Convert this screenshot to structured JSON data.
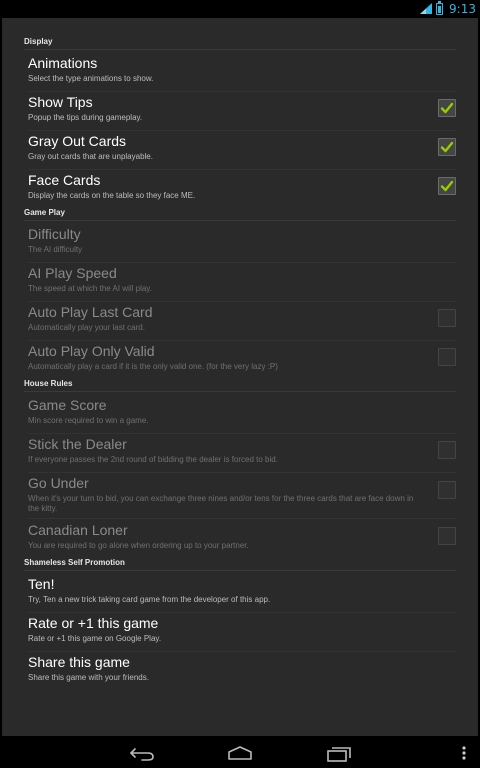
{
  "status_bar": {
    "time": "9:13"
  },
  "sections": {
    "display": "Display",
    "game_play": "Game Play",
    "house_rules": "House Rules",
    "promotion": "Shameless Self Promotion"
  },
  "prefs": {
    "animations": {
      "title": "Animations",
      "summary": "Select the type animations to show."
    },
    "show_tips": {
      "title": "Show Tips",
      "summary": "Popup the tips during gameplay.",
      "checked": true
    },
    "gray_out_cards": {
      "title": "Gray Out Cards",
      "summary": "Gray out cards that are unplayable.",
      "checked": true
    },
    "face_cards": {
      "title": "Face Cards",
      "summary": "Display the cards on the table so they face ME.",
      "checked": true
    },
    "difficulty": {
      "title": "Difficulty",
      "summary": "The AI difficulty"
    },
    "ai_play_speed": {
      "title": "AI Play Speed",
      "summary": "The speed at which the AI will play."
    },
    "auto_play_last_card": {
      "title": "Auto Play Last Card",
      "summary": "Automatically play your last card.",
      "checked": false
    },
    "auto_play_only_valid": {
      "title": "Auto Play Only Valid",
      "summary": "Automatically play a card if it is the only valid one. (for the very lazy :P)",
      "checked": false
    },
    "game_score": {
      "title": "Game Score",
      "summary": "Min score required to win a game."
    },
    "stick_the_dealer": {
      "title": "Stick the Dealer",
      "summary": "If everyone passes the 2nd round of bidding the dealer is forced to bid.",
      "checked": false
    },
    "go_under": {
      "title": "Go Under",
      "summary": "When it's your turn to bid, you can exchange three nines and/or tens for the three cards that are face down in the kitty.",
      "checked": false
    },
    "canadian_loner": {
      "title": "Canadian Loner",
      "summary": "You are required to go alone when ordering up to your partner.",
      "checked": false
    },
    "ten": {
      "title": "Ten!",
      "summary": "Try, Ten a new trick taking card game from the developer of this app."
    },
    "rate": {
      "title": "Rate or +1 this game",
      "summary": "Rate or +1 this game on Google Play."
    },
    "share": {
      "title": "Share this game",
      "summary": "Share this game with your friends."
    }
  },
  "colors": {
    "accent": "#33b5e5",
    "check": "#99cc00",
    "background": "#2a2a2a"
  },
  "icons": {
    "signal": "signal-icon",
    "battery": "battery-icon",
    "back": "back-icon",
    "home": "home-icon",
    "recents": "recents-icon",
    "overflow": "overflow-menu-icon",
    "check": "checkmark-icon"
  }
}
